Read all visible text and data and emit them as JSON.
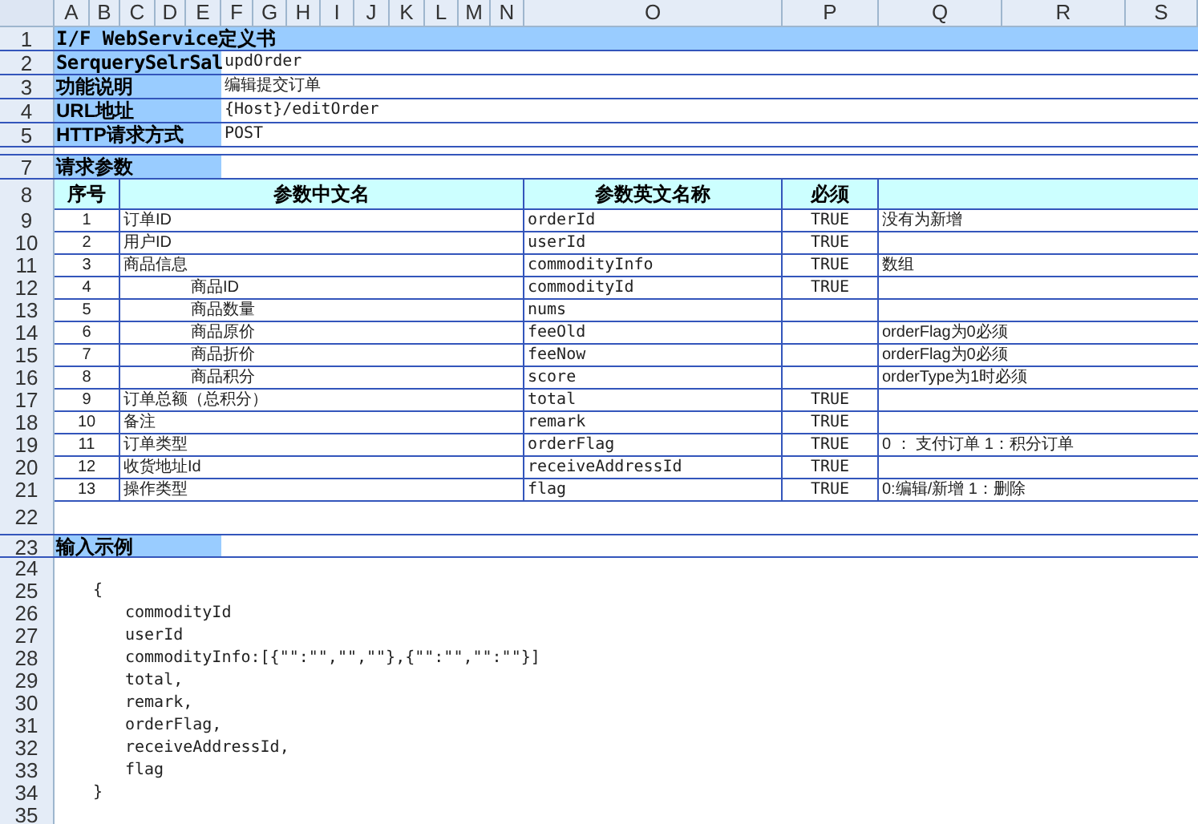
{
  "sheet": {
    "columns": [
      "A",
      "B",
      "C",
      "D",
      "E",
      "F",
      "G",
      "H",
      "I",
      "J",
      "K",
      "L",
      "M",
      "N",
      "O",
      "P",
      "Q",
      "R",
      "S"
    ],
    "row_numbers": [
      "1",
      "2",
      "3",
      "4",
      "5",
      "7",
      "8",
      "9",
      "10",
      "11",
      "12",
      "13",
      "14",
      "15",
      "16",
      "17",
      "18",
      "19",
      "20",
      "21",
      "22",
      "23",
      "24",
      "25",
      "26",
      "27",
      "28",
      "29",
      "30",
      "31",
      "32",
      "33",
      "34",
      "35"
    ]
  },
  "title": "I/F WebService定义书",
  "info": [
    {
      "label": "SerquerySelrSal",
      "value": "updOrder"
    },
    {
      "label": "功能说明",
      "value": "编辑提交订单"
    },
    {
      "label": "URL地址",
      "value": "{Host}/editOrder"
    },
    {
      "label": "HTTP请求方式",
      "value": "POST"
    }
  ],
  "request_params": {
    "label": "请求参数",
    "columns": [
      "序号",
      "参数中文名",
      "参数英文名称",
      "必须"
    ],
    "rows": [
      {
        "no": "1",
        "name_cn": "订单ID",
        "name_en": "orderId",
        "required": "TRUE",
        "note": "没有为新增"
      },
      {
        "no": "2",
        "name_cn": "用户ID",
        "name_en": "userId",
        "required": "TRUE"
      },
      {
        "no": "3",
        "name_cn": "商品信息",
        "name_en": "commodityInfo",
        "required": "TRUE",
        "note": "数组",
        "children": [
          {
            "no": "4",
            "name_cn": "商品ID",
            "name_en": "commodityId",
            "required": "TRUE"
          },
          {
            "no": "5",
            "name_cn": "商品数量",
            "name_en": "nums"
          },
          {
            "no": "6",
            "name_cn": "商品原价",
            "name_en": "feeOld",
            "note": "orderFlag为0必须"
          },
          {
            "no": "7",
            "name_cn": "商品折价",
            "name_en": "feeNow",
            "note": "orderFlag为0必须"
          },
          {
            "no": "8",
            "name_cn": "商品积分",
            "name_en": "score",
            "note": "orderType为1时必须"
          }
        ]
      },
      {
        "no": "9",
        "name_cn": "订单总额（总积分）",
        "name_en": "total",
        "required": "TRUE"
      },
      {
        "no": "10",
        "name_cn": "备注",
        "name_en": "remark",
        "required": "TRUE"
      },
      {
        "no": "11",
        "name_cn": "订单类型",
        "name_en": "orderFlag",
        "required": "TRUE",
        "note": "0 ： 支付订单 1：积分订单"
      },
      {
        "no": "12",
        "name_cn": "收货地址Id",
        "name_en": "receiveAddressId",
        "required": "TRUE"
      },
      {
        "no": "13",
        "name_cn": "操作类型",
        "name_en": "flag",
        "required": "TRUE",
        "note": "0:编辑/新增 1：删除"
      }
    ]
  },
  "input_example": {
    "label": "输入示例",
    "lines": [
      {
        "kind": "brace",
        "text": "{"
      },
      {
        "kind": "field",
        "text": "commodityId"
      },
      {
        "kind": "field",
        "text": "userId"
      },
      {
        "kind": "field",
        "text": "commodityInfo:[{\"\":\"\",\"\",\"\"},{\"\":\"\",\"\":\"\"}]"
      },
      {
        "kind": "field",
        "text": "total,"
      },
      {
        "kind": "field",
        "text": "remark,"
      },
      {
        "kind": "field",
        "text": "orderFlag,"
      },
      {
        "kind": "field",
        "text": "receiveAddressId,"
      },
      {
        "kind": "field",
        "text": "flag"
      },
      {
        "kind": "brace",
        "text": "}"
      }
    ]
  }
}
